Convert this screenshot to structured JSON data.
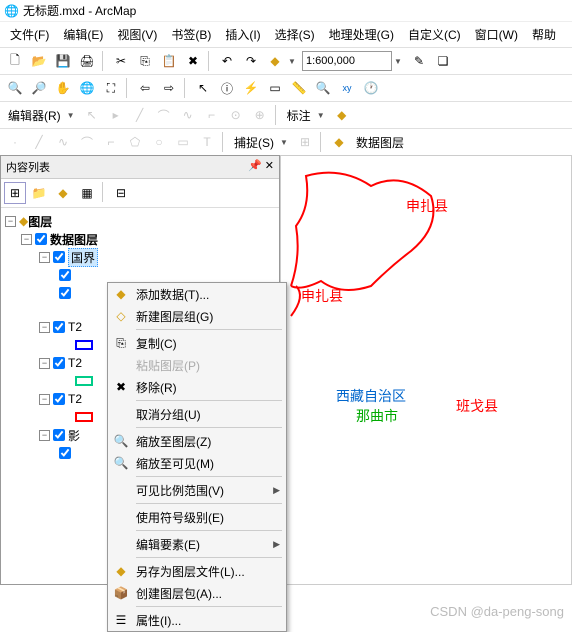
{
  "window": {
    "title": "无标题.mxd - ArcMap"
  },
  "menu": [
    "文件(F)",
    "编辑(E)",
    "视图(V)",
    "书签(B)",
    "插入(I)",
    "选择(S)",
    "地理处理(G)",
    "自定义(C)",
    "窗口(W)",
    "帮助"
  ],
  "scale": "1:600,000",
  "toolbar_labels": {
    "editor": "编辑器(R)",
    "annotate": "标注",
    "capture": "捕捉(S)",
    "data_layer": "数据图层"
  },
  "toc": {
    "title": "内容列表",
    "root": "图层",
    "data_layer": "数据图层",
    "selected": "国界",
    "t2_prefix": "T2",
    "last_group": "影"
  },
  "context_menu": {
    "add_data": "添加数据(T)...",
    "new_group": "新建图层组(G)",
    "copy": "复制(C)",
    "paste": "粘贴图层(P)",
    "remove": "移除(R)",
    "ungroup": "取消分组(U)",
    "zoom_layer": "缩放至图层(Z)",
    "zoom_visible": "缩放至可见(M)",
    "visible_scale": "可见比例范围(V)",
    "use_symbol": "使用符号级别(E)",
    "edit_feature": "编辑要素(E)",
    "save_as": "另存为图层文件(L)...",
    "create_pkg": "创建图层包(A)...",
    "props": "属性(I)..."
  },
  "map_labels": {
    "shenzha1": "申扎县",
    "shenzha2": "申扎县",
    "xizang": "西藏自治区",
    "naqu": "那曲市",
    "bange": "班戈县"
  },
  "watermark": "CSDN @da-peng-song"
}
